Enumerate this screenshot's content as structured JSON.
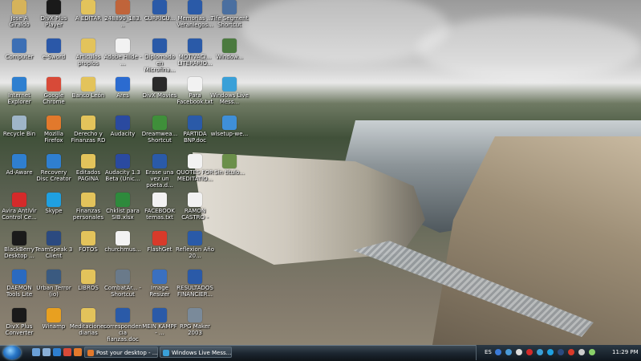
{
  "desktop_icons": [
    {
      "label": "Jose A Giraldo",
      "icon": "folder-user-icon",
      "color": "#d6b35a"
    },
    {
      "label": "DivX Plus Player",
      "icon": "divx-icon",
      "color": "#1a1a1a"
    },
    {
      "label": "A EDITAR",
      "icon": "folder-icon",
      "color": "#e3c35b"
    },
    {
      "label": "248890_183...",
      "icon": "image-file-icon",
      "color": "#c0643a"
    },
    {
      "label": "CURRICU...",
      "icon": "word-doc-icon",
      "color": "#2a5aa8"
    },
    {
      "label": "Memorias ... Veraniegos...",
      "icon": "word-doc-icon",
      "color": "#2a5aa8"
    },
    {
      "label": "Tlfe Segment Shortcut",
      "icon": "app-icon",
      "color": "#4a6fa0"
    },
    {
      "label": "Computer",
      "icon": "computer-icon",
      "color": "#3c6fb5"
    },
    {
      "label": "e-Sword",
      "icon": "sword-icon",
      "color": "#2b58a8"
    },
    {
      "label": "Articulos propios",
      "icon": "folder-icon",
      "color": "#e3c35b"
    },
    {
      "label": "Adobe Hilde - ...",
      "icon": "pdf-icon",
      "color": "#f2f2f2"
    },
    {
      "label": "Diplomado en Microfina...",
      "icon": "word-doc-icon",
      "color": "#2a5aa8"
    },
    {
      "label": "MOTIVACI... LITERARIO...",
      "icon": "word-doc-icon",
      "color": "#2a5aa8"
    },
    {
      "label": "Window...",
      "icon": "window-icon",
      "color": "#4b7a3f"
    },
    {
      "label": "Internet Explorer",
      "icon": "ie-icon",
      "color": "#2e7fd0"
    },
    {
      "label": "Google Chrome",
      "icon": "chrome-icon",
      "color": "#d84a38"
    },
    {
      "label": "Banco León",
      "icon": "folder-icon",
      "color": "#e3c35b"
    },
    {
      "label": "Ares",
      "icon": "ares-icon",
      "color": "#2b6bd0"
    },
    {
      "label": "DivX Movies",
      "icon": "divx-icon",
      "color": "#2a2a2a"
    },
    {
      "label": "Para Facebook.txt",
      "icon": "text-file-icon",
      "color": "#f2f2f2"
    },
    {
      "label": "Windows Live Mess...",
      "icon": "messenger-icon",
      "color": "#3aa0d8"
    },
    {
      "label": "Recycle Bin",
      "icon": "recycle-bin-icon",
      "color": "#9fb5c8"
    },
    {
      "label": "Mozilla Firefox",
      "icon": "firefox-icon",
      "color": "#e2792c"
    },
    {
      "label": "Derecho y Finanzas RD",
      "icon": "folder-icon",
      "color": "#e3c35b"
    },
    {
      "label": "Audacity",
      "icon": "audacity-icon",
      "color": "#2a4aa0"
    },
    {
      "label": "Dreamwea... Shortcut",
      "icon": "dreamweaver-icon",
      "color": "#3f8f3a"
    },
    {
      "label": "PARTIDA BNP.doc",
      "icon": "word-doc-icon",
      "color": "#2a5aa8"
    },
    {
      "label": "wlsetup-we...",
      "icon": "windows-icon",
      "color": "#3f8fd8"
    },
    {
      "label": "Ad-Aware",
      "icon": "ad-aware-icon",
      "color": "#2f7fd0"
    },
    {
      "label": "Recovery Disc Creator",
      "icon": "recovery-icon",
      "color": "#2f7fd0"
    },
    {
      "label": "Editados PAGINA",
      "icon": "folder-icon",
      "color": "#e3c35b"
    },
    {
      "label": "Audacity 1.3 Beta (Unic...",
      "icon": "audacity-icon",
      "color": "#2a4aa0"
    },
    {
      "label": "Erase una vez un poeta.d...",
      "icon": "word-doc-icon",
      "color": "#2a5aa8"
    },
    {
      "label": "QUOTES FOR MEDITATIO...",
      "icon": "text-file-icon",
      "color": "#f2f2f2"
    },
    {
      "label": "Sin titulo...",
      "icon": "image-file-icon",
      "color": "#6b8f4a"
    },
    {
      "label": "Avira AntiVir Control Ce...",
      "icon": "avira-icon",
      "color": "#d42a2a"
    },
    {
      "label": "Skype",
      "icon": "skype-icon",
      "color": "#1fa0e0"
    },
    {
      "label": "Finanzas personales",
      "icon": "folder-icon",
      "color": "#e3c35b"
    },
    {
      "label": "Chklist para SIB.xlsx",
      "icon": "excel-icon",
      "color": "#2e8a3c"
    },
    {
      "label": "FACEBOOK temas.txt",
      "icon": "text-file-icon",
      "color": "#f2f2f2"
    },
    {
      "label": "RAMON CASTRO -",
      "icon": "text-file-icon",
      "color": "#f2f2f2"
    },
    {
      "label": "BlackBerry Desktop ...",
      "icon": "blackberry-icon",
      "color": "#1a1a1a"
    },
    {
      "label": "TeamSpeak 3 Client",
      "icon": "teamspeak-icon",
      "color": "#2b4a80"
    },
    {
      "label": "FOTOS",
      "icon": "folder-icon",
      "color": "#e3c35b"
    },
    {
      "label": "churchmus...",
      "icon": "text-file-icon",
      "color": "#f2f2f2"
    },
    {
      "label": "FlashGet",
      "icon": "flashget-icon",
      "color": "#d83a2a"
    },
    {
      "label": "Reflexion Año 20...",
      "icon": "word-doc-icon",
      "color": "#2a5aa8"
    },
    {
      "label": "DAEMON Tools Lite",
      "icon": "daemon-icon",
      "color": "#2a6ac0"
    },
    {
      "label": "Urban Terror (io)",
      "icon": "urban-terror-icon",
      "color": "#3a5a80"
    },
    {
      "label": "LIBROS",
      "icon": "folder-icon",
      "color": "#e3c35b"
    },
    {
      "label": "CombatAr... - Shortcut",
      "icon": "app-icon",
      "color": "#6a7a8a"
    },
    {
      "label": "Image Resizer",
      "icon": "image-resizer-icon",
      "color": "#3a70c0"
    },
    {
      "label": "RESULTADOS FINANCIER...",
      "icon": "word-doc-icon",
      "color": "#2a5aa8"
    },
    {
      "label": "DivX Plus Converter",
      "icon": "divx-icon",
      "color": "#1a1a1a"
    },
    {
      "label": "Winamp",
      "icon": "winamp-icon",
      "color": "#e8a020"
    },
    {
      "label": "Meditaciones diarias",
      "icon": "folder-icon",
      "color": "#e3c35b"
    },
    {
      "label": "correspondencia fianzas.doc",
      "icon": "word-doc-icon",
      "color": "#2a5aa8"
    },
    {
      "label": "MEIN KAMPF - ...",
      "icon": "word-doc-icon",
      "color": "#2a5aa8"
    },
    {
      "label": "RPG Maker 2003",
      "icon": "rpg-maker-icon",
      "color": "#7a8a9a"
    }
  ],
  "taskbar": {
    "quicklaunch": [
      {
        "icon": "show-desktop-icon",
        "color": "#6aa0d8"
      },
      {
        "icon": "switch-windows-icon",
        "color": "#8ab0d8"
      },
      {
        "icon": "ie-icon",
        "color": "#2e7fd0"
      },
      {
        "icon": "chrome-icon",
        "color": "#d84a38"
      },
      {
        "icon": "firefox-icon",
        "color": "#e2792c"
      }
    ],
    "tasks": [
      {
        "label": "Post your desktop - ...",
        "icon": "firefox-icon",
        "color": "#e2792c"
      },
      {
        "label": "Windows Live Mess...",
        "icon": "messenger-icon",
        "color": "#3aa0d8"
      }
    ],
    "tray": {
      "language": "ES",
      "clock": "11:29 PM",
      "icons": [
        {
          "icon": "help-icon",
          "color": "#3a7ad8"
        },
        {
          "icon": "network-icon",
          "color": "#4a9ad8"
        },
        {
          "icon": "blackberry-tray-icon",
          "color": "#dddddd"
        },
        {
          "icon": "avira-tray-icon",
          "color": "#d42a2a"
        },
        {
          "icon": "messenger-tray-icon",
          "color": "#3aa0d8"
        },
        {
          "icon": "skype-tray-icon",
          "color": "#1fa0e0"
        },
        {
          "icon": "teamspeak-tray-icon",
          "color": "#2b4a80"
        },
        {
          "icon": "flashget-tray-icon",
          "color": "#d83a2a"
        },
        {
          "icon": "volume-icon",
          "color": "#cccccc"
        },
        {
          "icon": "power-icon",
          "color": "#8ad06a"
        }
      ]
    }
  }
}
